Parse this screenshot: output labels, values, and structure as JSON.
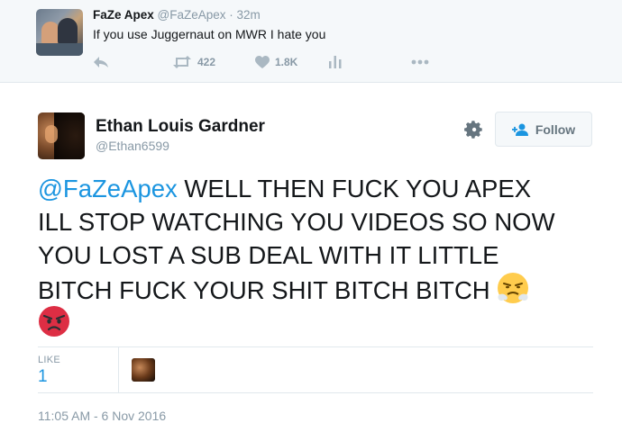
{
  "parent_tweet": {
    "author_name": "FaZe Apex",
    "author_handle": "@FaZeApex",
    "time_ago": "· 32m",
    "text": "If you use Juggernaut on MWR I hate you",
    "retweet_count": "422",
    "like_count": "1.8K",
    "icons": [
      "reply-icon",
      "retweet-icon",
      "heart-icon",
      "analytics-icon",
      "more-icon"
    ]
  },
  "tweet": {
    "author_name": "Ethan Louis Gardner",
    "author_handle": "@Ethan6599",
    "follow_label": "Follow",
    "mention": "@FaZeApex",
    "lines": [
      " WELL THEN FUCK YOU APEX",
      "ILL STOP WATCHING YOU VIDEOS SO NOW",
      "YOU LOST A SUB DEAL WITH IT LITTLE",
      "BITCH FUCK YOUR SHIT BITCH BITCH "
    ],
    "emojis": [
      "triumph-face-emoji",
      "pouting-face-emoji"
    ],
    "likes_label": "LIKE",
    "likes_count": "1",
    "timestamp": "11:05 AM - 6 Nov 2016"
  },
  "colors": {
    "accent": "#1b95e0",
    "muted": "#8899a6",
    "border": "#e1e8ed"
  }
}
